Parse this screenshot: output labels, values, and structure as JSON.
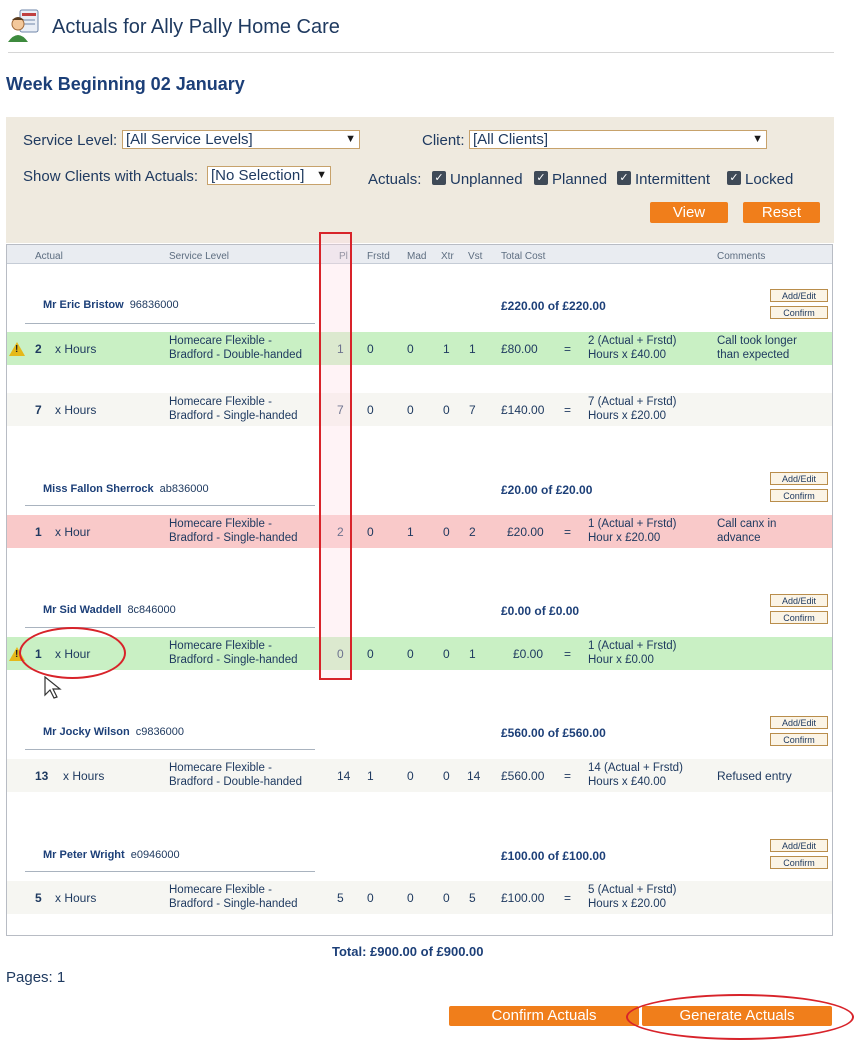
{
  "header": {
    "title": "Actuals for Ally Pally Home Care",
    "week": "Week Beginning 02 January"
  },
  "filters": {
    "service_level_label": "Service Level:",
    "service_level_value": "[All Service Levels]",
    "client_label": "Client:",
    "client_value": "[All Clients]",
    "show_clients_label": "Show Clients with Actuals:",
    "show_clients_value": "[No Selection]",
    "actuals_label": "Actuals:",
    "checkboxes": [
      "Unplanned",
      "Planned",
      "Intermittent",
      "Locked"
    ],
    "view_button": "View",
    "reset_button": "Reset"
  },
  "table": {
    "headers": [
      "Actual",
      "Service Level",
      "Pl",
      "Frstd",
      "Mad",
      "Xtr",
      "Vst",
      "Total Cost",
      "Comments"
    ],
    "add_edit_label": "Add/Edit",
    "confirm_label": "Confirm",
    "clients": [
      {
        "name": "Mr Eric Bristow",
        "id": "96836000",
        "total": "£220.00 of £220.00"
      },
      {
        "name": "Miss Fallon Sherrock",
        "id": "ab836000",
        "total": "£20.00 of £20.00"
      },
      {
        "name": "Mr Sid Waddell",
        "id": "8c846000",
        "total": "£0.00 of £0.00"
      },
      {
        "name": "Mr Jocky Wilson",
        "id": "c9836000",
        "total": "£560.00 of £560.00"
      },
      {
        "name": "Mr Peter Wright",
        "id": "e0946000",
        "total": "£100.00 of £100.00"
      }
    ],
    "rows": [
      {
        "qty": "2",
        "unit": "x Hours",
        "svc1": "Homecare Flexible -",
        "svc2": "Bradford - Double-handed",
        "pl": "1",
        "frstd": "0",
        "mad": "0",
        "xtr": "1",
        "vst": "1",
        "cost": "£80.00",
        "eq": "=",
        "calc1": "2 (Actual + Frstd)",
        "calc2": "Hours x £40.00",
        "comment1": "Call took longer",
        "comment2": "than expected",
        "color": "#c9f0c4",
        "warning": true
      },
      {
        "qty": "7",
        "unit": "x Hours",
        "svc1": "Homecare Flexible -",
        "svc2": "Bradford - Single-handed",
        "pl": "7",
        "frstd": "0",
        "mad": "0",
        "xtr": "0",
        "vst": "7",
        "cost": "£140.00",
        "eq": "=",
        "calc1": "7 (Actual + Frstd)",
        "calc2": "Hours x £20.00",
        "comment1": "",
        "comment2": "",
        "color": "#f6f6f2",
        "warning": false
      },
      {
        "qty": "1",
        "unit": "x Hour",
        "svc1": "Homecare Flexible -",
        "svc2": "Bradford - Single-handed",
        "pl": "2",
        "frstd": "0",
        "mad": "1",
        "xtr": "0",
        "vst": "2",
        "cost": "£20.00",
        "eq": "=",
        "calc1": "1 (Actual + Frstd)",
        "calc2": "Hour x £20.00",
        "comment1": "Call canx in",
        "comment2": "advance",
        "color": "#f9c9c9",
        "warning": false
      },
      {
        "qty": "1",
        "unit": "x Hour",
        "svc1": "Homecare Flexible -",
        "svc2": "Bradford - Single-handed",
        "pl": "0",
        "frstd": "0",
        "mad": "0",
        "xtr": "0",
        "vst": "1",
        "cost": "£0.00",
        "eq": "=",
        "calc1": "1 (Actual + Frstd)",
        "calc2": "Hour x £0.00",
        "comment1": "",
        "comment2": "",
        "color": "#c9f0c4",
        "warning": true
      },
      {
        "qty": "13",
        "unit": "x Hours",
        "svc1": "Homecare Flexible -",
        "svc2": "Bradford - Double-handed",
        "pl": "14",
        "frstd": "1",
        "mad": "0",
        "xtr": "0",
        "vst": "14",
        "cost": "£560.00",
        "eq": "=",
        "calc1": "14 (Actual + Frstd)",
        "calc2": "Hours x £40.00",
        "comment1": "Refused entry",
        "comment2": "",
        "color": "#f6f6f2",
        "warning": false
      },
      {
        "qty": "5",
        "unit": "x Hours",
        "svc1": "Homecare Flexible -",
        "svc2": "Bradford - Single-handed",
        "pl": "5",
        "frstd": "0",
        "mad": "0",
        "xtr": "0",
        "vst": "5",
        "cost": "£100.00",
        "eq": "=",
        "calc1": "5 (Actual + Frstd)",
        "calc2": "Hours x £20.00",
        "comment1": "",
        "comment2": "",
        "color": "#f6f6f2",
        "warning": false
      }
    ]
  },
  "footer": {
    "total": "Total: £900.00  of £900.00",
    "pages": "Pages: 1",
    "confirm_actuals": "Confirm Actuals",
    "generate_actuals": "Generate Actuals"
  },
  "colors": {
    "accent": "#f07e1b",
    "heading": "#1c3f78",
    "annotation": "#d8232a"
  }
}
